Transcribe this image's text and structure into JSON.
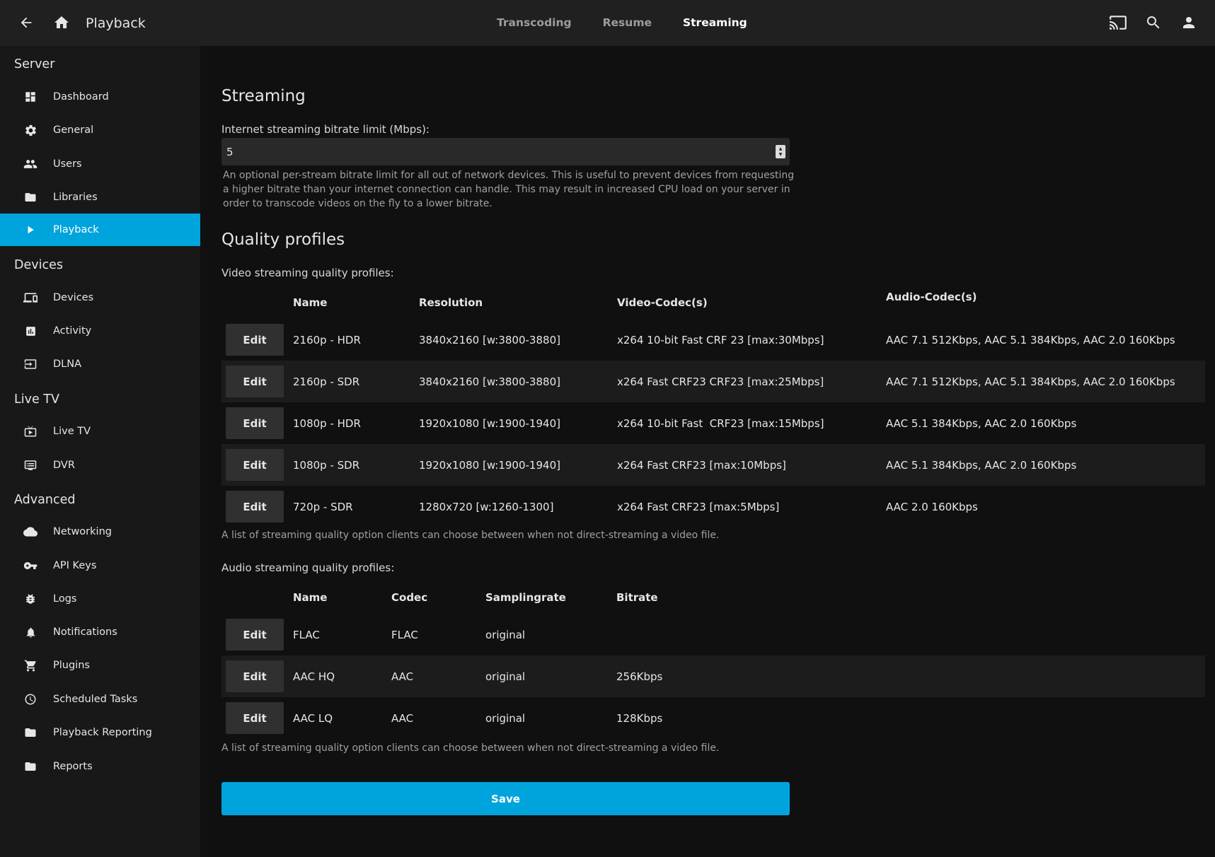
{
  "header": {
    "title": "Playback",
    "tabs": [
      {
        "label": "Transcoding",
        "active": false
      },
      {
        "label": "Resume",
        "active": false
      },
      {
        "label": "Streaming",
        "active": true
      }
    ],
    "icons": [
      "back-arrow-icon",
      "home-icon",
      "cast-icon",
      "search-icon",
      "user-icon"
    ]
  },
  "sidebar": {
    "sections": [
      {
        "label": "Server"
      },
      {
        "label": "Devices"
      },
      {
        "label": "Live TV"
      },
      {
        "label": "Advanced"
      }
    ],
    "items": [
      {
        "label": "Dashboard",
        "icon": "dashboard-icon"
      },
      {
        "label": "General",
        "icon": "gear-icon"
      },
      {
        "label": "Users",
        "icon": "users-icon"
      },
      {
        "label": "Libraries",
        "icon": "folder-icon"
      },
      {
        "label": "Playback",
        "icon": "play-icon",
        "active": true
      },
      {
        "label": "Devices",
        "icon": "devices-icon"
      },
      {
        "label": "Activity",
        "icon": "activity-chart-icon"
      },
      {
        "label": "DLNA",
        "icon": "dlna-input-icon"
      },
      {
        "label": "Live TV",
        "icon": "live-tv-icon"
      },
      {
        "label": "DVR",
        "icon": "dvr-icon"
      },
      {
        "label": "Networking",
        "icon": "cloud-icon"
      },
      {
        "label": "API Keys",
        "icon": "key-icon"
      },
      {
        "label": "Logs",
        "icon": "bug-icon"
      },
      {
        "label": "Notifications",
        "icon": "bell-icon"
      },
      {
        "label": "Plugins",
        "icon": "cart-icon"
      },
      {
        "label": "Scheduled Tasks",
        "icon": "clock-icon"
      },
      {
        "label": "Playback Reporting",
        "icon": "folder-icon"
      },
      {
        "label": "Reports",
        "icon": "folder-icon"
      }
    ]
  },
  "streaming": {
    "title": "Streaming",
    "bitrate_label": "Internet streaming bitrate limit (Mbps):",
    "bitrate_value": "5",
    "bitrate_desc_lines": [
      "An optional per-stream bitrate limit for all out of network devices. This is useful to prevent devices from requesting",
      "a higher bitrate than your internet connection can handle. This may result in increased CPU load on your server in",
      "order to transcode videos on the fly to a lower bitrate."
    ]
  },
  "quality": {
    "title": "Quality profiles",
    "video_label": "Video streaming quality profiles:",
    "video_headers": [
      "Name",
      "Resolution",
      "Video-Codec(s)",
      "Audio-Codec(s)"
    ],
    "video_rows": [
      {
        "name": "2160p - HDR",
        "resolution": "3840x2160 [w:3800-3880]",
        "video": "x264 10-bit Fast CRF 23 [max:30Mbps]",
        "audio": "AAC 7.1 512Kbps, AAC 5.1 384Kbps, AAC 2.0 160Kbps"
      },
      {
        "name": "2160p - SDR",
        "resolution": "3840x2160 [w:3800-3880]",
        "video": "x264 Fast CRF23 CRF23 [max:25Mbps]",
        "audio": "AAC 7.1 512Kbps, AAC 5.1 384Kbps, AAC 2.0 160Kbps"
      },
      {
        "name": "1080p - HDR",
        "resolution": "1920x1080 [w:1900-1940]",
        "video": "x264 10-bit Fast  CRF23 [max:15Mbps]",
        "audio": "AAC 5.1 384Kbps, AAC 2.0 160Kbps"
      },
      {
        "name": "1080p - SDR",
        "resolution": "1920x1080 [w:1900-1940]",
        "video": "x264 Fast CRF23 [max:10Mbps]",
        "audio": "AAC 5.1 384Kbps, AAC 2.0 160Kbps"
      },
      {
        "name": "720p - SDR",
        "resolution": "1280x720 [w:1260-1300]",
        "video": "x264 Fast CRF23 [max:5Mbps]",
        "audio": "AAC 2.0 160Kbps"
      }
    ],
    "video_desc": "A list of streaming quality option clients can choose between when not direct-streaming a video file.",
    "audio_label": "Audio streaming quality profiles:",
    "audio_headers": [
      "Name",
      "Codec",
      "Samplingrate",
      "Bitrate"
    ],
    "audio_rows": [
      {
        "name": "FLAC",
        "codec": "FLAC",
        "samplingrate": "original",
        "bitrate": ""
      },
      {
        "name": "AAC HQ",
        "codec": "AAC",
        "samplingrate": "original",
        "bitrate": "256Kbps"
      },
      {
        "name": "AAC LQ",
        "codec": "AAC",
        "samplingrate": "original",
        "bitrate": "128Kbps"
      }
    ],
    "audio_desc": "A list of streaming quality option clients can choose between when not direct-streaming a video file.",
    "edit_label": "Edit"
  },
  "save_label": "Save",
  "colors": {
    "accent": "#00a4dc",
    "header": "#202020",
    "sidebar": "#181818",
    "background": "#101010"
  }
}
